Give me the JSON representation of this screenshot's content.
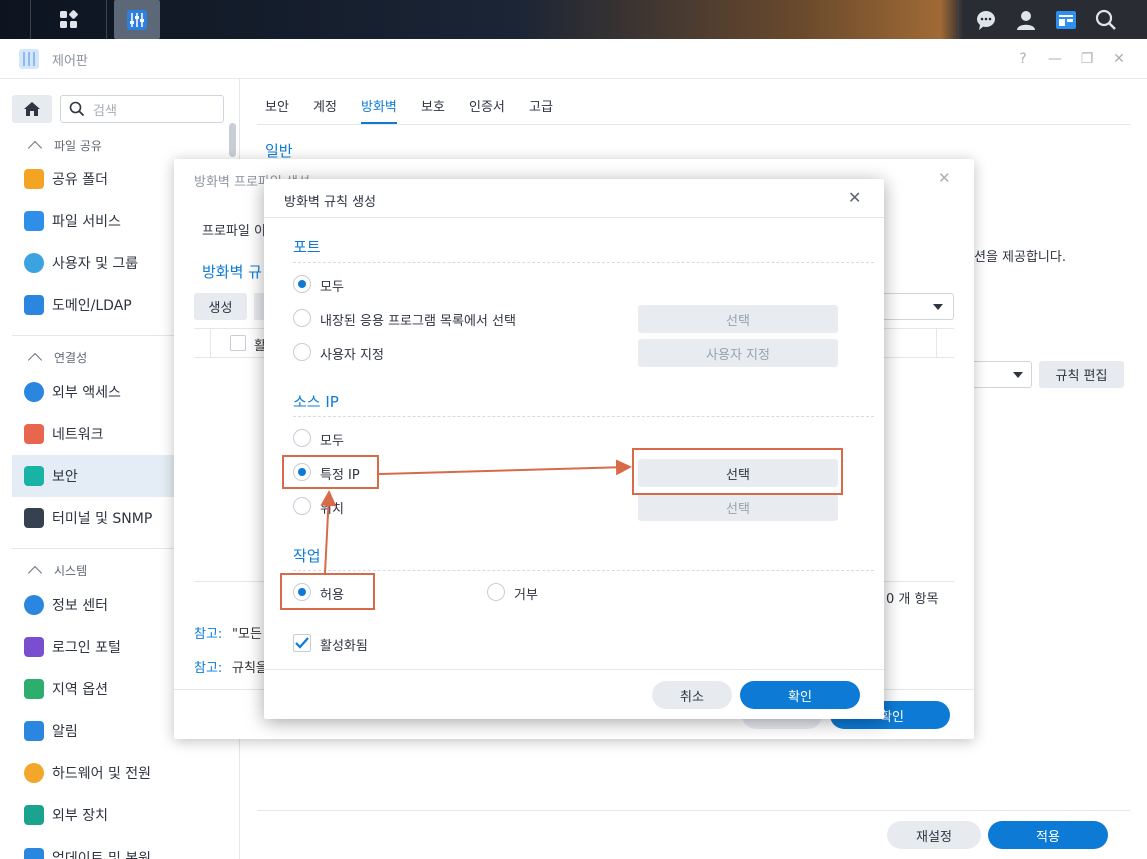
{
  "taskbar": {
    "icons": [
      "apps-grid-icon",
      "control-panel-icon",
      "chat-icon",
      "user-icon",
      "widgets-icon",
      "search-icon"
    ]
  },
  "window": {
    "title": "제어판",
    "controls": {
      "help": "?",
      "minimize": "—",
      "restore": "❐",
      "close": "✕"
    }
  },
  "sidebar": {
    "search_placeholder": "검색",
    "groups": [
      {
        "label": "파일 공유",
        "items": [
          "공유 폴더",
          "파일 서비스",
          "사용자 및 그룹",
          "도메인/LDAP"
        ]
      },
      {
        "label": "연결성",
        "items": [
          "외부 액세스",
          "네트워크",
          "보안",
          "터미널 및 SNMP"
        ]
      },
      {
        "label": "시스템",
        "items": [
          "정보 센터",
          "로그인 포털",
          "지역 옵션",
          "알림",
          "하드웨어 및 전원",
          "외부 장치",
          "업데이트 및 복원"
        ]
      }
    ]
  },
  "main": {
    "tabs": [
      "보안",
      "계정",
      "방화벽",
      "보호",
      "인증서",
      "고급"
    ],
    "active_tab": "방화벽",
    "section_title": "일반",
    "desc_tail": "션을 제공합니다.",
    "rule_edit_button": "규칙 편집",
    "reset_button": "재설정",
    "apply_button": "적용"
  },
  "back_dialog": {
    "title": "방화벽 프로파일 생성",
    "profile_label": "프로파일 이",
    "rules_title": "방화벽 규",
    "create_button": "생성",
    "col_partial": "활",
    "item_count": "0 개 항목",
    "note_label": "참고:",
    "note1": "\"모든",
    "note2": "규칙을",
    "ok_partial": "확인"
  },
  "dialog": {
    "title": "방화벽 규칙 생성",
    "port": {
      "title": "포트",
      "options": [
        "모두",
        "내장된 응용 프로그램 목록에서 선택",
        "사용자 지정"
      ],
      "selected": 0,
      "select_button": "선택",
      "custom_button": "사용자 지정"
    },
    "source_ip": {
      "title": "소스 IP",
      "options": [
        "모두",
        "특정 IP",
        "위치"
      ],
      "selected": 1,
      "select_button": "선택",
      "location_button": "선택"
    },
    "action": {
      "title": "작업",
      "options": [
        "허용",
        "거부"
      ],
      "selected": 0
    },
    "enabled_label": "활성화됨",
    "enabled": true,
    "cancel_button": "취소",
    "ok_button": "확인"
  },
  "colors": {
    "accent": "#0d7bd6",
    "annotation": "#d86a4a"
  }
}
